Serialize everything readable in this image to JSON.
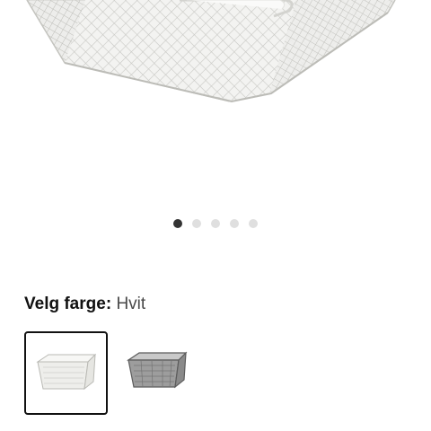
{
  "gallery": {
    "slides": 5,
    "active_index": 0,
    "image_icon": "wire-mesh-basket-icon"
  },
  "color_picker": {
    "label": "Velg farge:",
    "selected_value": "Hvit",
    "swatches": [
      {
        "color_name": "Hvit",
        "fill": "#f1f1ee",
        "stroke": "#b9b9b4",
        "selected": true,
        "icon": "white-mesh-basket-icon"
      },
      {
        "color_name": "Grå",
        "fill": "#9b9b9b",
        "stroke": "#5c5c5c",
        "selected": false,
        "icon": "gray-mesh-basket-icon"
      }
    ]
  },
  "colors": {
    "dot_active": "#333333",
    "dot_inactive": "#dfdfdf",
    "selected_border": "#111111"
  }
}
